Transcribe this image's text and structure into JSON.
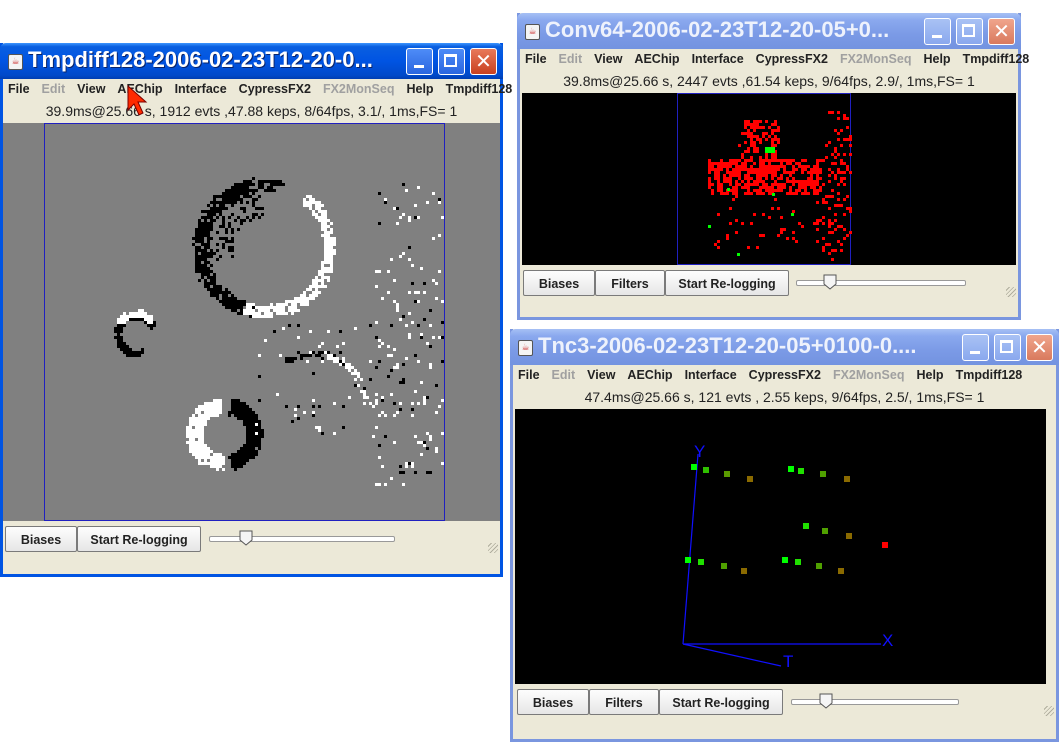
{
  "windows": {
    "tmpdiff": {
      "title": "Tmpdiff128-2006-02-23T12-20-0...",
      "menu": [
        {
          "label": "File",
          "enabled": true
        },
        {
          "label": "Edit",
          "enabled": false
        },
        {
          "label": "View",
          "enabled": true
        },
        {
          "label": "AEChip",
          "enabled": true
        },
        {
          "label": "Interface",
          "enabled": true
        },
        {
          "label": "CypressFX2",
          "enabled": true
        },
        {
          "label": "FX2MonSeq",
          "enabled": false
        },
        {
          "label": "Help",
          "enabled": true
        },
        {
          "label": "Tmpdiff128",
          "enabled": true
        }
      ],
      "status": "39.9ms@25.66   s, 1912 evts ,47.88 keps, 8/64fps,  3.1/, 1ms,FS= 1",
      "buttons": {
        "biases": "Biases",
        "relog": "Start Re-logging"
      },
      "slider_value": 0.2
    },
    "conv64": {
      "title": "Conv64-2006-02-23T12-20-05+0...",
      "menu": [
        {
          "label": "File",
          "enabled": true
        },
        {
          "label": "Edit",
          "enabled": false
        },
        {
          "label": "View",
          "enabled": true
        },
        {
          "label": "AEChip",
          "enabled": true
        },
        {
          "label": "Interface",
          "enabled": true
        },
        {
          "label": "CypressFX2",
          "enabled": true
        },
        {
          "label": "FX2MonSeq",
          "enabled": false
        },
        {
          "label": "Help",
          "enabled": true
        },
        {
          "label": "Tmpdiff128",
          "enabled": true
        }
      ],
      "status": "39.8ms@25.66   s, 2447 evts ,61.54 keps, 9/64fps,  2.9/, 1ms,FS= 1",
      "buttons": {
        "biases": "Biases",
        "filters": "Filters",
        "relog": "Start Re-logging"
      },
      "slider_value": 0.2
    },
    "tnc3": {
      "title": "Tnc3-2006-02-23T12-20-05+0100-0....",
      "menu": [
        {
          "label": "File",
          "enabled": true
        },
        {
          "label": "Edit",
          "enabled": false
        },
        {
          "label": "View",
          "enabled": true
        },
        {
          "label": "AEChip",
          "enabled": true
        },
        {
          "label": "Interface",
          "enabled": true
        },
        {
          "label": "CypressFX2",
          "enabled": true
        },
        {
          "label": "FX2MonSeq",
          "enabled": false
        },
        {
          "label": "Help",
          "enabled": true
        },
        {
          "label": "Tmpdiff128",
          "enabled": true
        }
      ],
      "status": "47.4ms@25.66   s, 121 evts , 2.55 keps, 9/64fps,  2.5/, 1ms,FS= 1",
      "buttons": {
        "biases": "Biases",
        "filters": "Filters",
        "relog": "Start Re-logging"
      },
      "slider_value": 0.2,
      "axes": {
        "x": "X",
        "y": "Y",
        "t": "T"
      }
    }
  },
  "icons": {
    "window": "java-cup-icon",
    "minimize": "minimize-icon",
    "maximize": "maximize-icon",
    "close": "close-icon",
    "cursor": "mouse-pointer-icon"
  },
  "colors": {
    "titlebar_active": "#0054e3",
    "titlebar_inactive": "#7b9ae6",
    "event_on": "#ffffff",
    "event_off": "#000000",
    "conv_red": "#ff0000",
    "conv_green": "#00ff00",
    "tnc_axes": "#1010ff"
  }
}
